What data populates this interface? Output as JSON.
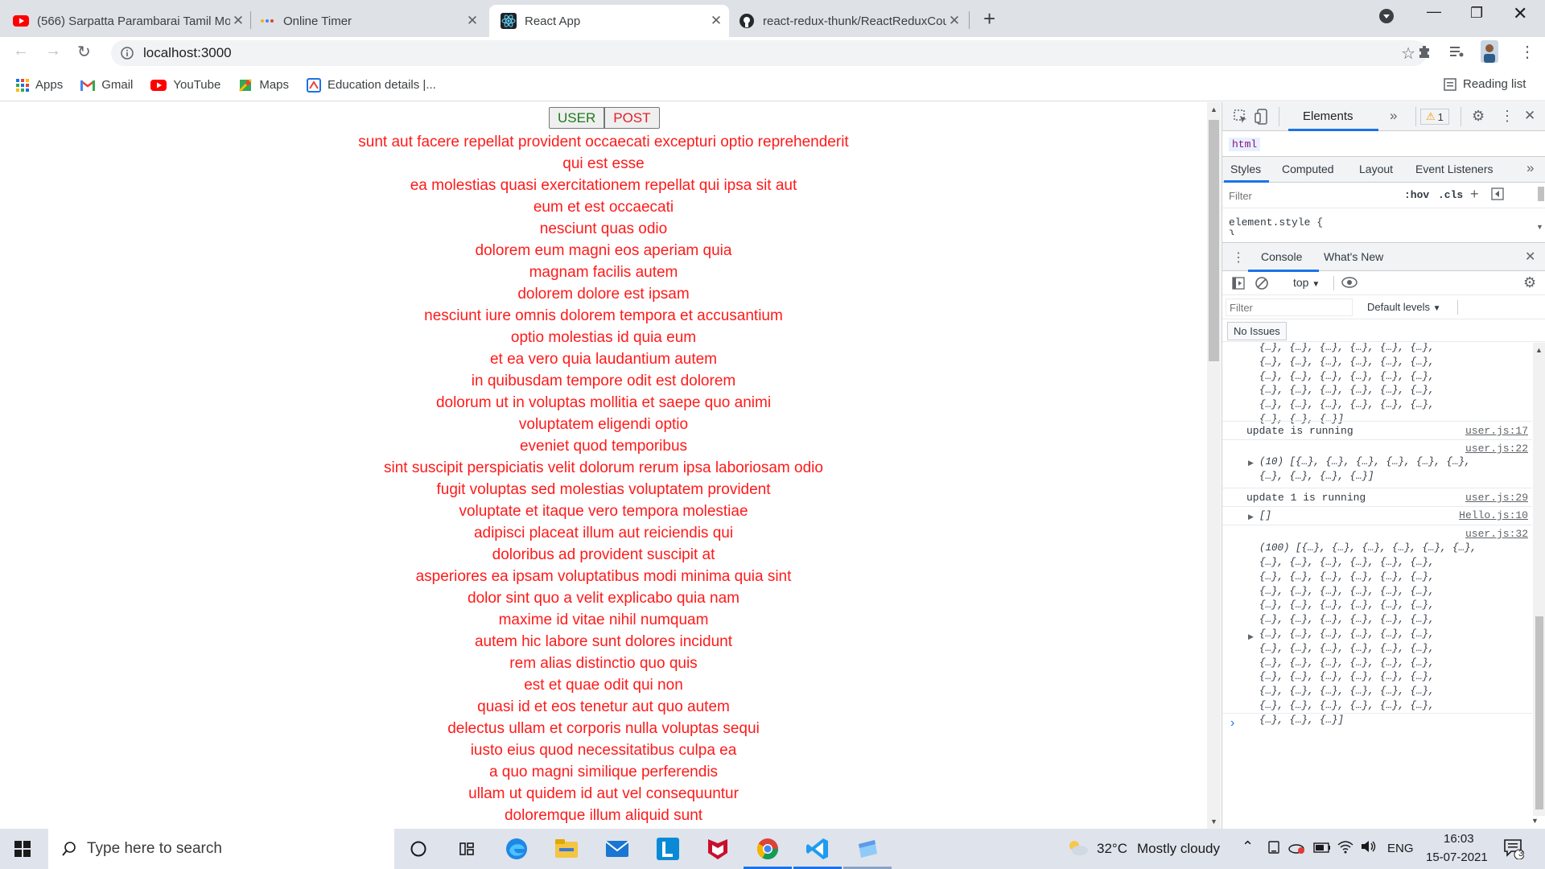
{
  "browser": {
    "tabs": [
      {
        "title": "(566) Sarpatta Parambarai Tamil Movie",
        "icon": "youtube-icon",
        "active": false
      },
      {
        "title": "Online Timer",
        "icon": "timer-icon",
        "active": false
      },
      {
        "title": "React App",
        "icon": "react-icon",
        "active": true
      },
      {
        "title": "react-redux-thunk/ReactReduxCounter",
        "icon": "github-icon",
        "active": false
      }
    ],
    "url": "localhost:3000",
    "bookmarks": [
      {
        "label": "Apps",
        "icon": "apps-grid-icon"
      },
      {
        "label": "Gmail",
        "icon": "gmail-icon"
      },
      {
        "label": "YouTube",
        "icon": "youtube-icon"
      },
      {
        "label": "Maps",
        "icon": "maps-icon"
      },
      {
        "label": "Education details |...",
        "icon": "education-icon"
      }
    ],
    "reading_list": "Reading list"
  },
  "app": {
    "user_button": "USER",
    "post_button": "POST",
    "titles": [
      "sunt aut facere repellat provident occaecati excepturi optio reprehenderit",
      "qui est esse",
      "ea molestias quasi exercitationem repellat qui ipsa sit aut",
      "eum et est occaecati",
      "nesciunt quas odio",
      "dolorem eum magni eos aperiam quia",
      "magnam facilis autem",
      "dolorem dolore est ipsam",
      "nesciunt iure omnis dolorem tempora et accusantium",
      "optio molestias id quia eum",
      "et ea vero quia laudantium autem",
      "in quibusdam tempore odit est dolorem",
      "dolorum ut in voluptas mollitia et saepe quo animi",
      "voluptatem eligendi optio",
      "eveniet quod temporibus",
      "sint suscipit perspiciatis velit dolorum rerum ipsa laboriosam odio",
      "fugit voluptas sed molestias voluptatem provident",
      "voluptate et itaque vero tempora molestiae",
      "adipisci placeat illum aut reiciendis qui",
      "doloribus ad provident suscipit at",
      "asperiores ea ipsam voluptatibus modi minima quia sint",
      "dolor sint quo a velit explicabo quia nam",
      "maxime id vitae nihil numquam",
      "autem hic labore sunt dolores incidunt",
      "rem alias distinctio quo quis",
      "est et quae odit qui non",
      "quasi id et eos tenetur aut quo autem",
      "delectus ullam et corporis nulla voluptas sequi",
      "iusto eius quod necessitatibus culpa ea",
      "a quo magni similique perferendis",
      "ullam ut quidem id aut vel consequuntur",
      "doloremque illum aliquid sunt"
    ]
  },
  "devtools": {
    "main_tab": "Elements",
    "warning_count": "1",
    "breadcrumb": "html",
    "style_tabs": [
      "Styles",
      "Computed",
      "Layout",
      "Event Listeners"
    ],
    "filter_placeholder": "Filter",
    "hov": ":hov",
    "cls": ".cls",
    "element_style": "element.style {",
    "element_style_close": "}",
    "drawer_tabs": [
      "Console",
      "What's New"
    ],
    "context": "top",
    "console_filter_placeholder": "Filter",
    "default_levels": "Default levels",
    "no_issues": "No Issues",
    "obj_row": "{…}, {…}, {…}, {…}, {…}, {…},",
    "obj_row_end": "{…}, {…}, {…}]",
    "logs": {
      "l1": "update is running",
      "l1_src": "user.js:17",
      "l2_src": "user.js:22",
      "l2_line1": "(10) [{…}, {…}, {…}, {…}, {…}, {…},",
      "l2_line2": "{…}, {…}, {…}, {…}]",
      "l3": "update 1 is running",
      "l3_src": "user.js:29",
      "l4": "[]",
      "l4_src": "Hello.js:10",
      "l5_src": "user.js:32",
      "l5_line1": "(100) [{…}, {…}, {…}, {…}, {…}, {…},"
    },
    "prompt": "›"
  },
  "taskbar": {
    "search_placeholder": "Type here to search",
    "weather_temp": "32°C",
    "weather_text": "Mostly cloudy",
    "lang": "ENG",
    "time": "16:03",
    "date": "15-07-2021",
    "notification_count": "3"
  },
  "colors": {
    "title_text": "#ff1a1a",
    "user_button_text": "#1e7a1e",
    "post_button_text": "#e0202a",
    "accent": "#1a73e8"
  }
}
